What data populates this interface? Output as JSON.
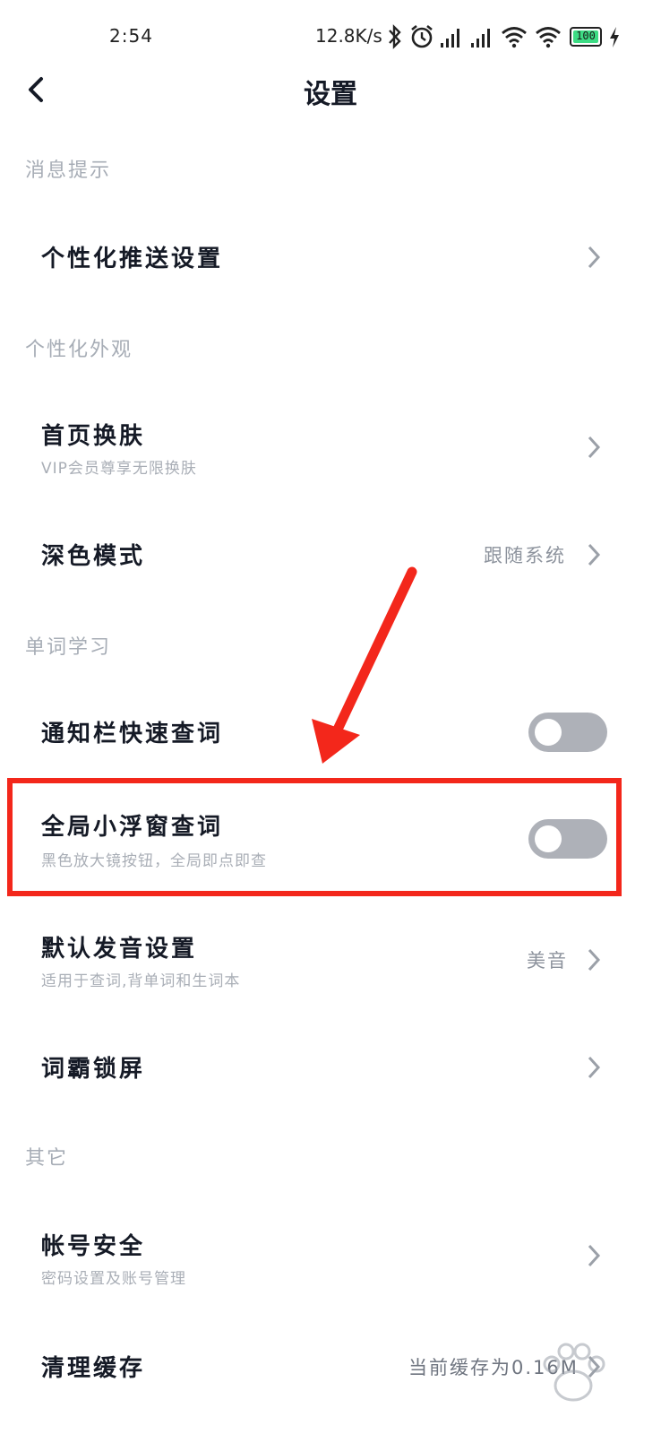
{
  "status_bar": {
    "time": "2:54",
    "speed": "12.8K/s",
    "battery": "100",
    "icons": [
      "bluetooth-icon",
      "alarm-icon",
      "signal-icon",
      "signal-icon",
      "wifi-icon",
      "wifi-icon",
      "battery-icon",
      "charging-icon"
    ]
  },
  "header": {
    "title": "设置",
    "back_icon": "chevron-left-icon"
  },
  "sections": [
    {
      "label": "消息提示"
    },
    {
      "label": "个性化外观"
    },
    {
      "label": "单词学习"
    },
    {
      "label": "其它"
    }
  ],
  "items": {
    "push": {
      "title": "个性化推送设置"
    },
    "skin": {
      "title": "首页换肤",
      "subtitle": "VIP会员尊享无限换肤"
    },
    "dark": {
      "title": "深色模式",
      "value": "跟随系统"
    },
    "notify_lookup": {
      "title": "通知栏快速查词",
      "toggle_on": false
    },
    "float_lookup": {
      "title": "全局小浮窗查词",
      "subtitle": "黑色放大镜按钮，全局即点即查",
      "toggle_on": false
    },
    "pronounce": {
      "title": "默认发音设置",
      "subtitle": "适用于查词,背单词和生词本",
      "value": "美音"
    },
    "lockscreen": {
      "title": "词霸锁屏"
    },
    "account": {
      "title": "帐号安全",
      "subtitle": "密码设置及账号管理"
    },
    "cache": {
      "title": "清理缓存",
      "value": "当前缓存为0.16M"
    }
  },
  "colors": {
    "annotation_red": "#f3271b",
    "toggle_off": "#aeb1b8",
    "section_gray": "#a7adb6"
  }
}
